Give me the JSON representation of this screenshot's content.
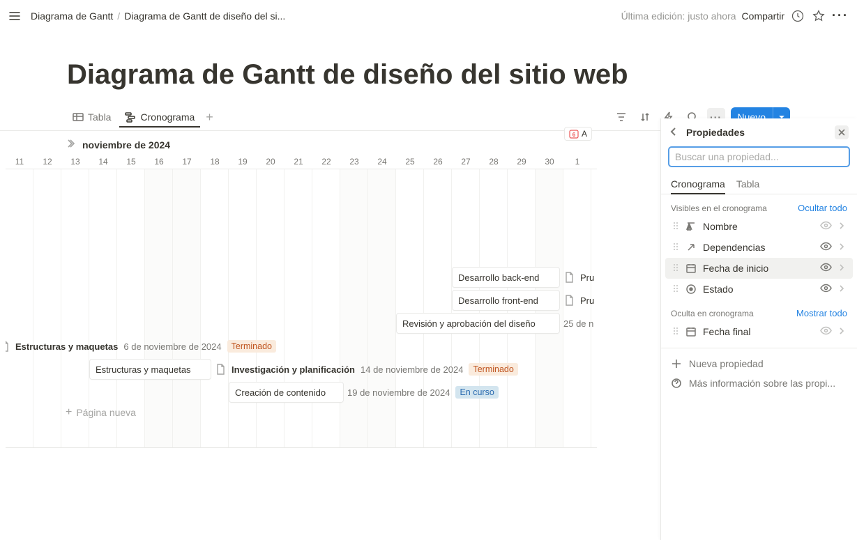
{
  "breadcrumb": {
    "root": "Diagrama de Gantt",
    "page": "Diagrama de Gantt de diseño del si..."
  },
  "topbar": {
    "lastEdit": "Última edición: justo ahora",
    "share": "Compartir"
  },
  "title": "Diagrama de Gantt de diseño del sitio web",
  "tabs": {
    "table": "Tabla",
    "timeline": "Cronograma",
    "newBtn": "Nuevo"
  },
  "month": "noviembre de 2024",
  "todayPill": "A",
  "todayDay": "6",
  "days": [
    "11",
    "12",
    "13",
    "14",
    "15",
    "16",
    "17",
    "18",
    "19",
    "20",
    "21",
    "22",
    "23",
    "24",
    "25",
    "26",
    "27",
    "28",
    "29",
    "30",
    "1"
  ],
  "bars": {
    "backend": "Desarrollo back-end",
    "backendTrail": "Pru",
    "frontend": "Desarrollo front-end",
    "frontendTrail": "Pru",
    "review": "Revisión y aprobación del diseño",
    "reviewDate": "25 de n",
    "struct1": "Estructuras y maquetas",
    "struct1Date": "6 de noviembre de 2024",
    "struct1Tag": "Terminado",
    "struct2": "Estructuras y maquetas",
    "research": "Investigación y planificación",
    "researchDate": "14 de noviembre de 2024",
    "researchTag": "Terminado",
    "content": "Creación de contenido",
    "contentDate": "19 de noviembre de 2024",
    "contentTag": "En curso",
    "newPage": "Página nueva"
  },
  "panel": {
    "title": "Propiedades",
    "searchPlaceholder": "Buscar una propiedad...",
    "tabs": {
      "timeline": "Cronograma",
      "table": "Tabla"
    },
    "visibleHeader": "Visibles en el cronograma",
    "hideAll": "Ocultar todo",
    "hiddenHeader": "Oculta en cronograma",
    "showAll": "Mostrar todo",
    "props": {
      "name": "Nombre",
      "deps": "Dependencias",
      "startDate": "Fecha de inicio",
      "status": "Estado",
      "endDate": "Fecha final"
    },
    "newProp": "Nueva propiedad",
    "moreInfo": "Más información sobre las propi..."
  }
}
